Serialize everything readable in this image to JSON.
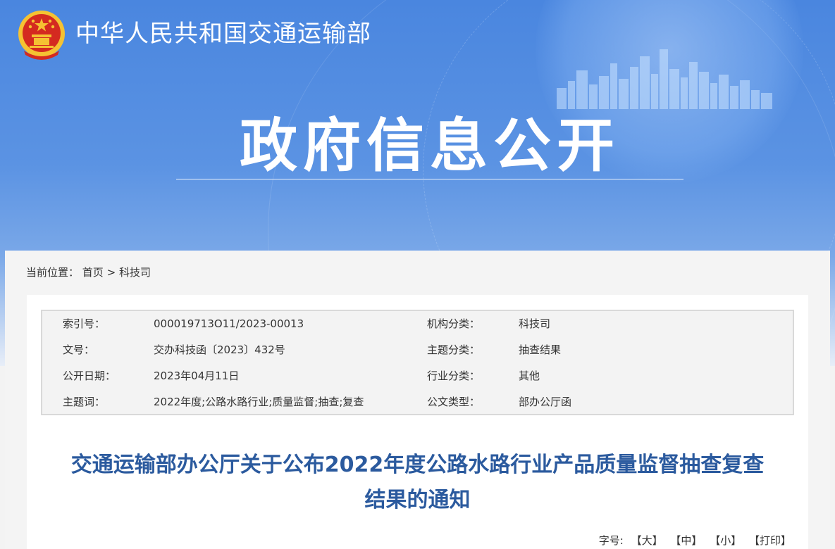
{
  "header": {
    "ministry_name": "中华人民共和国交通运输部",
    "section_title": "政府信息公开"
  },
  "breadcrumb": {
    "prefix": "当前位置：",
    "home": "首页",
    "separator": ">",
    "current": "科技司"
  },
  "meta": {
    "rows": [
      {
        "label1": "索引号：",
        "value1": "000019713O11/2023-00013",
        "label2": "机构分类：",
        "value2": "科技司"
      },
      {
        "label1": "文号：",
        "value1": "交办科技函〔2023〕432号",
        "label2": "主题分类：",
        "value2": "抽查结果"
      },
      {
        "label1": "公开日期：",
        "value1": "2023年04月11日",
        "label2": "行业分类：",
        "value2": "其他"
      },
      {
        "label1": "主题词：",
        "value1": "2022年度;公路水路行业;质量监督;抽查;复查",
        "label2": "公文类型：",
        "value2": "部办公厅函"
      }
    ]
  },
  "document": {
    "title_line1": "交通运输部办公厅关于公布2022年度公路水路行业产品质量监督抽查复查",
    "title_line2": "结果的通知"
  },
  "font_size": {
    "label": "字号:",
    "large": "【大】",
    "medium": "【中】",
    "small": "【小】",
    "print": "【打印】"
  },
  "colors": {
    "banner_blue": "#4a86df",
    "title_blue": "#2b5a9e",
    "emblem_red": "#d42a20",
    "emblem_gold": "#f5c232"
  }
}
